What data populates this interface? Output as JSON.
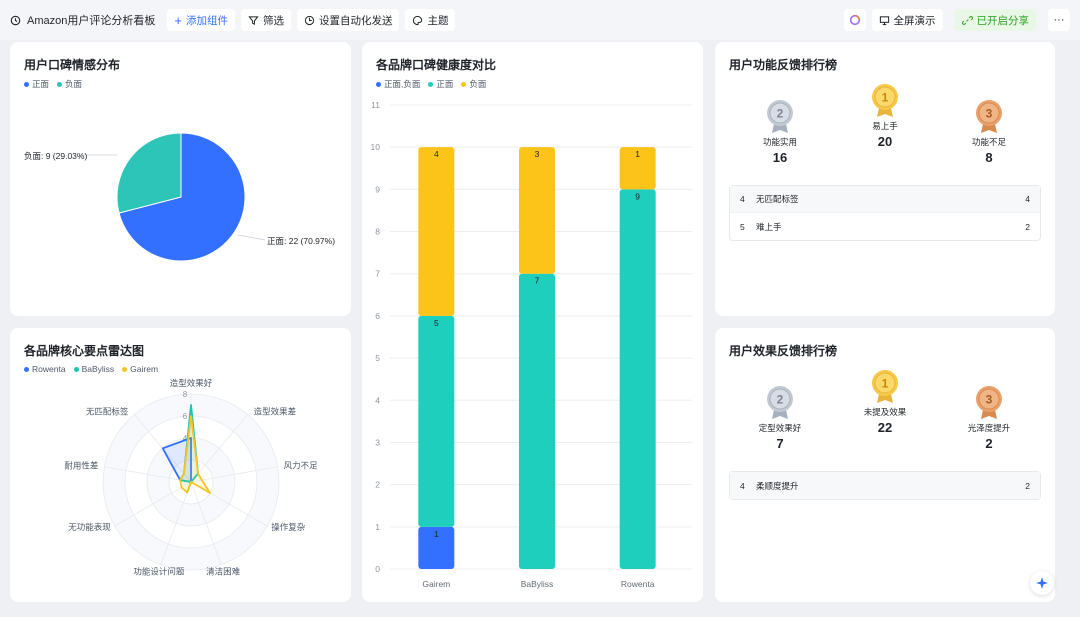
{
  "toolbar": {
    "title": "Amazon用户评论分析看板",
    "add_component": "添加组件",
    "filter": "筛选",
    "automation": "设置自动化发送",
    "theme": "主题",
    "fullscreen": "全屏演示",
    "share": "已开启分享",
    "more": "···"
  },
  "sentiment": {
    "title": "用户口碑情感分布",
    "legend": [
      "正面",
      "负面"
    ],
    "neg_label": "负面: 9 (29.03%)",
    "pos_label": "正面: 22 (70.97%)",
    "colors": {
      "positive": "#3370ff",
      "negative": "#2dc5b7"
    }
  },
  "radar": {
    "title": "各品牌核心要点雷达图",
    "legend": [
      "Rowenta",
      "BaByliss",
      "Gairem"
    ],
    "axes": [
      "造型效果好",
      "造型效果差",
      "风力不足",
      "操作复杂",
      "清洁困难",
      "功能设计问题",
      "无功能表现",
      "耐用性差",
      "无匹配标签"
    ],
    "ticks": [
      "8",
      "6",
      "4"
    ],
    "colors": {
      "Rowenta": "#3370ff",
      "BaByliss": "#1bc4b3",
      "Gairem": "#f6c423"
    }
  },
  "health": {
    "title": "各品牌口碑健康度对比",
    "legend": [
      "正面,负面",
      "正面",
      "负面"
    ],
    "colors": {
      "mixed": "#3370ff",
      "positive": "#1ecfbd",
      "negative": "#fcc419"
    }
  },
  "chart_data": [
    {
      "type": "pie",
      "title": "用户口碑情感分布",
      "series": [
        {
          "name": "正面",
          "value": 22,
          "percent": 70.97
        },
        {
          "name": "负面",
          "value": 9,
          "percent": 29.03
        }
      ]
    },
    {
      "type": "bar",
      "stacked": true,
      "title": "各品牌口碑健康度对比",
      "categories": [
        "Gairem",
        "BaByliss",
        "Rowenta"
      ],
      "series": [
        {
          "name": "正面,负面",
          "values": [
            1,
            0,
            0
          ]
        },
        {
          "name": "正面",
          "values": [
            5,
            7,
            9
          ]
        },
        {
          "name": "负面",
          "values": [
            4,
            3,
            1
          ]
        }
      ],
      "ylim": [
        0,
        11
      ],
      "yticks": [
        0,
        1,
        2,
        3,
        4,
        5,
        6,
        7,
        8,
        9,
        10,
        11
      ],
      "grid": true,
      "legend": "top-left"
    },
    {
      "type": "radar",
      "title": "各品牌核心要点雷达图",
      "axes": [
        "造型效果好",
        "造型效果差",
        "风力不足",
        "操作复杂",
        "清洁困难",
        "功能设计问题",
        "无功能表现",
        "耐用性差",
        "无匹配标签"
      ],
      "range": [
        0,
        8
      ],
      "series": [
        {
          "name": "Rowenta",
          "values": [
            4,
            0,
            0,
            0,
            0,
            0,
            0,
            1,
            4
          ]
        },
        {
          "name": "BaByliss",
          "values": [
            7,
            1,
            0,
            0,
            0,
            1,
            0,
            1,
            1
          ]
        },
        {
          "name": "Gairem",
          "values": [
            6,
            1,
            1,
            2,
            0,
            1,
            1,
            1,
            1
          ]
        }
      ],
      "legend": "top-left"
    }
  ],
  "func_rank": {
    "title": "用户功能反馈排行榜",
    "top": [
      {
        "rank": "2",
        "name": "功能实用",
        "value": "16"
      },
      {
        "rank": "1",
        "name": "易上手",
        "value": "20"
      },
      {
        "rank": "3",
        "name": "功能不足",
        "value": "8"
      }
    ],
    "rows": [
      {
        "idx": "4",
        "name": "无匹配标签",
        "value": "4"
      },
      {
        "idx": "5",
        "name": "难上手",
        "value": "2"
      }
    ]
  },
  "effect_rank": {
    "title": "用户效果反馈排行榜",
    "top": [
      {
        "rank": "2",
        "name": "定型效果好",
        "value": "7"
      },
      {
        "rank": "1",
        "name": "未提及效果",
        "value": "22"
      },
      {
        "rank": "3",
        "name": "光泽度提升",
        "value": "2"
      }
    ],
    "rows": [
      {
        "idx": "4",
        "name": "柔顺度提升",
        "value": "2"
      }
    ]
  }
}
